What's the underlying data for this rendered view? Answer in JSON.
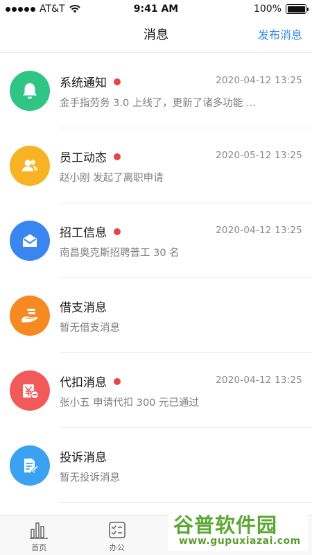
{
  "status_bar": {
    "carrier": "AT&T",
    "time": "9:41 AM",
    "battery": "100%"
  },
  "header": {
    "title": "消息",
    "action_label": "发布消息"
  },
  "messages": [
    {
      "title": "系统通知",
      "time": "2020-04-12 13:25",
      "desc": "金手指劳务 3.0 上线了，更新了诸多功能 ...",
      "unread": true,
      "icon": "bell-icon",
      "color": "#2fc584"
    },
    {
      "title": "员工动态",
      "time": "2020-05-12 13:25",
      "desc": "赵小刚 发起了离职申请",
      "unread": true,
      "icon": "people-icon",
      "color": "#f7b324"
    },
    {
      "title": "招工信息",
      "time": "2020-04-12 13:25",
      "desc": "南昌奥克斯招聘普工 30 名",
      "unread": true,
      "icon": "envelope-icon",
      "color": "#3a86f0"
    },
    {
      "title": "借支消息",
      "time": "",
      "desc": "暂无借支消息",
      "unread": false,
      "icon": "hand-money-icon",
      "color": "#f58a23"
    },
    {
      "title": "代扣消息",
      "time": "2020-04-12 13:25",
      "desc": "张小五 申请代扣 300 元已通过",
      "unread": true,
      "icon": "yuan-deduct-icon",
      "color": "#f25a5a"
    },
    {
      "title": "投诉消息",
      "time": "",
      "desc": "暂无投诉消息",
      "unread": false,
      "icon": "document-edit-icon",
      "color": "#3aa2f0"
    }
  ],
  "tabs": [
    {
      "label": "首页",
      "icon": "bar-chart-icon"
    },
    {
      "label": "办公",
      "icon": "checklist-icon"
    },
    {
      "label": "",
      "icon": ""
    },
    {
      "label": "",
      "icon": ""
    }
  ],
  "watermark": {
    "cn": "谷普软件园",
    "en": "www.gupuxiazai.com"
  }
}
